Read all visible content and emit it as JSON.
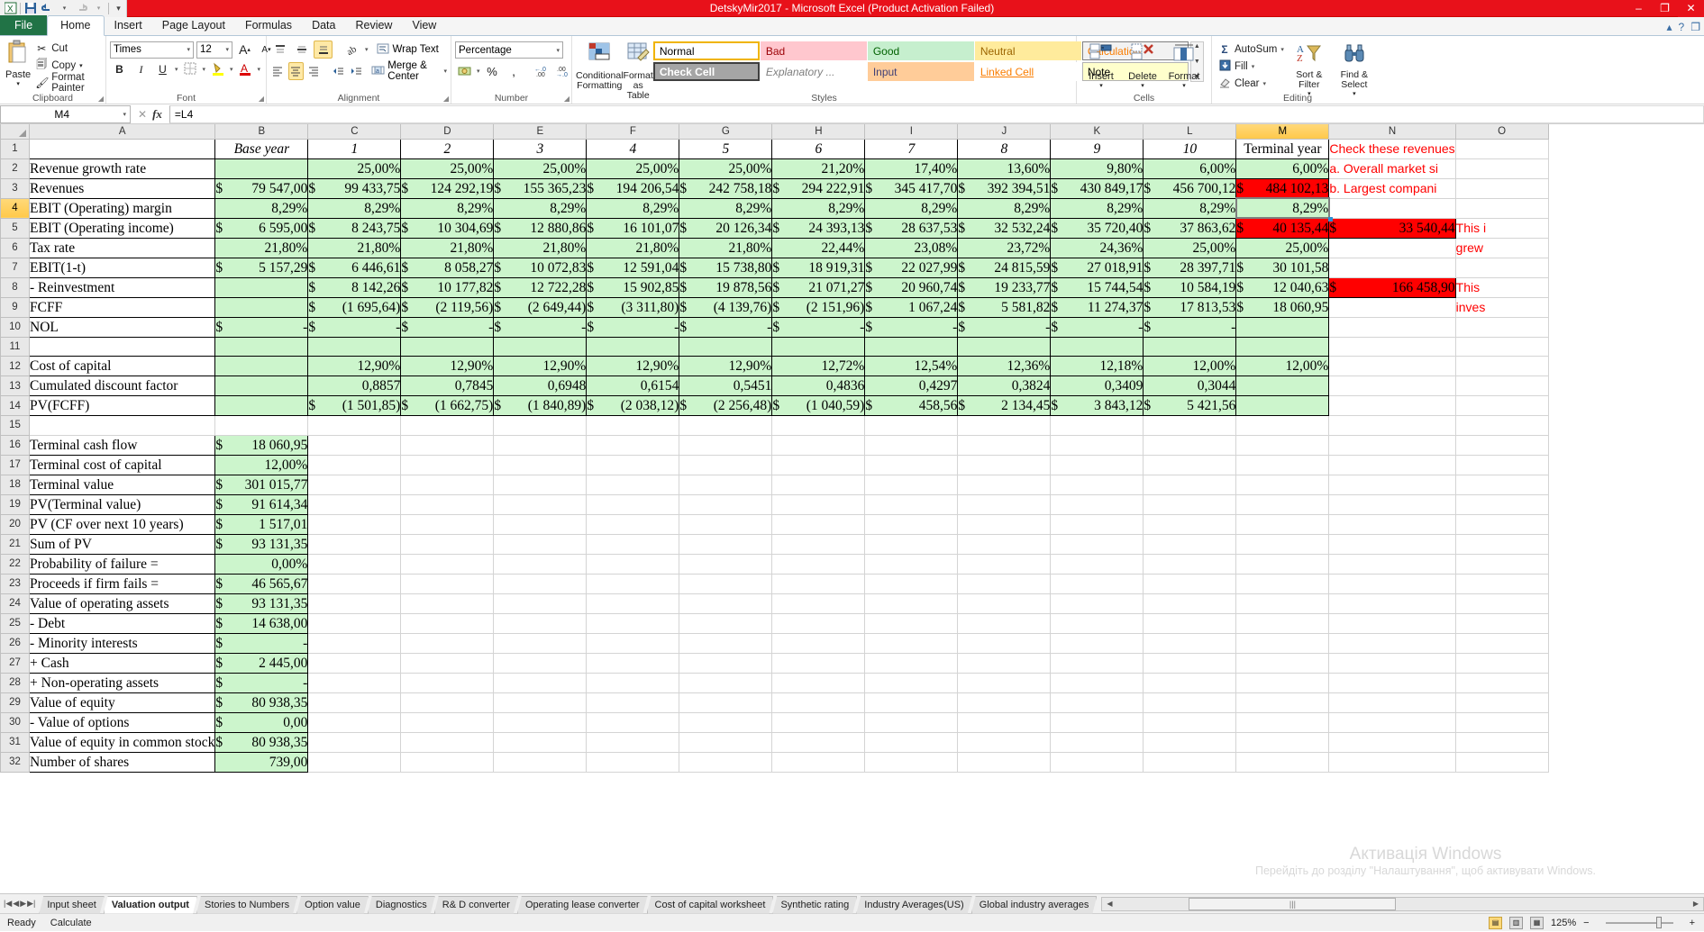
{
  "window": {
    "title": "DetskyMir2017  -  Microsoft Excel (Product Activation Failed)",
    "minimize": "–",
    "maximize": "❐",
    "close": "✕"
  },
  "quick_access": {
    "excel": "X",
    "save": "ὋE",
    "undo": "↶",
    "redo": "↷",
    "customize": "▾"
  },
  "ribbon_tabs": [
    {
      "label": "File",
      "active": false
    },
    {
      "label": "Home",
      "active": true
    },
    {
      "label": "Insert",
      "active": false
    },
    {
      "label": "Page Layout",
      "active": false
    },
    {
      "label": "Formulas",
      "active": false
    },
    {
      "label": "Data",
      "active": false
    },
    {
      "label": "Review",
      "active": false
    },
    {
      "label": "View",
      "active": false
    }
  ],
  "help_icons": {
    "minimize_ribbon": "▴",
    "help": "?",
    "restore": "❐"
  },
  "clipboard": {
    "group_label": "Clipboard",
    "paste": "Paste",
    "cut": "Cut",
    "copy": "Copy",
    "format_painter": "Format Painter"
  },
  "font_group": {
    "group_label": "Font",
    "font_name": "Times",
    "font_size": "12",
    "grow_font": "A",
    "shrink_font": "A",
    "bold": "B",
    "italic": "I",
    "underline": "U",
    "borders": "▦",
    "fill_color": "A",
    "font_color": "A"
  },
  "alignment_group": {
    "group_label": "Alignment",
    "wrap_text": "Wrap Text",
    "merge_center": "Merge & Center",
    "align_top": "≡",
    "align_middle": "≡",
    "align_bottom": "≡",
    "orientation": "↱",
    "align_left": "≡",
    "align_center": "≡",
    "align_right": "≡",
    "decrease_indent": "⇤",
    "increase_indent": "⇥"
  },
  "number_group": {
    "group_label": "Number",
    "format": "Percentage",
    "accounting": "$",
    "percent": "%",
    "comma": ",",
    "increase_decimal": ".00",
    "decrease_decimal": ".0"
  },
  "styles_group": {
    "group_label": "Styles",
    "conditional_formatting": "Conditional Formatting",
    "format_as_table": "Format as Table",
    "cells": [
      {
        "label": "Normal",
        "cls": "sc-normal"
      },
      {
        "label": "Bad",
        "cls": "sc-bad"
      },
      {
        "label": "Good",
        "cls": "sc-good"
      },
      {
        "label": "Neutral",
        "cls": "sc-neutral"
      },
      {
        "label": "Calculation",
        "cls": "sc-calc"
      },
      {
        "label": "Check Cell",
        "cls": "sc-check"
      },
      {
        "label": "Explanatory ...",
        "cls": "sc-expl"
      },
      {
        "label": "Input",
        "cls": "sc-input"
      },
      {
        "label": "Linked Cell",
        "cls": "sc-linked"
      },
      {
        "label": "Note",
        "cls": "sc-note"
      }
    ]
  },
  "cells_group": {
    "group_label": "Cells",
    "insert": "Insert",
    "delete": "Delete",
    "format": "Format"
  },
  "editing_group": {
    "group_label": "Editing",
    "autosum": "AutoSum",
    "fill": "Fill",
    "clear": "Clear",
    "sort_filter": "Sort & Filter",
    "find_select": "Find & Select"
  },
  "formula_bar": {
    "name_box": "M4",
    "formula": "=L4",
    "cancel": "✕",
    "enter": "✓",
    "fx": "fx"
  },
  "grid": {
    "columns": [
      "A",
      "B",
      "C",
      "D",
      "E",
      "F",
      "G",
      "H",
      "I",
      "J",
      "K",
      "L",
      "M",
      "N",
      "O"
    ],
    "selected_column": "M",
    "selected_row": 4,
    "headers_row": {
      "row": 1,
      "A": "",
      "B": "Base year",
      "years": [
        "1",
        "2",
        "3",
        "4",
        "5",
        "6",
        "7",
        "8",
        "9",
        "10"
      ],
      "M": "Terminal year"
    },
    "rows": [
      {
        "n": 2,
        "label": "Revenue growth rate",
        "cells": [
          "",
          "25,00%",
          "25,00%",
          "25,00%",
          "25,00%",
          "25,00%",
          "21,20%",
          "17,40%",
          "13,60%",
          "9,80%",
          "6,00%",
          "6,00%"
        ],
        "style": "pct"
      },
      {
        "n": 3,
        "label": "Revenues",
        "cells": [
          "$  79 547,00",
          "$  99 433,75",
          "$ 124 292,19",
          "$ 155 365,23",
          "$ 194 206,54",
          "$ 242 758,18",
          "$ 294 222,91",
          "$ 345 417,70",
          "$ 392 394,51",
          "$ 430 849,17",
          "$ 456 700,12",
          "$ 484 102,13"
        ],
        "style": "money",
        "red_last": true
      },
      {
        "n": 4,
        "label": "EBIT (Operating) margin",
        "cells": [
          "8,29%",
          "8,29%",
          "8,29%",
          "8,29%",
          "8,29%",
          "8,29%",
          "8,29%",
          "8,29%",
          "8,29%",
          "8,29%",
          "8,29%",
          "8,29%"
        ],
        "style": "pct"
      },
      {
        "n": 5,
        "label": "EBIT (Operating income)",
        "cells": [
          "$   6 595,00",
          "$   8 243,75",
          "$  10 304,69",
          "$  12 880,86",
          "$  16 101,07",
          "$  20 126,34",
          "$  24 393,13",
          "$  28 637,53",
          "$  32 532,24",
          "$  35 720,40",
          "$  37 863,62",
          "$  40 135,44"
        ],
        "style": "money",
        "red_last": true,
        "extra_n": "$       33 540,44",
        "extra_n_red": true
      },
      {
        "n": 6,
        "label": "Tax rate",
        "cells": [
          "21,80%",
          "21,80%",
          "21,80%",
          "21,80%",
          "21,80%",
          "21,80%",
          "22,44%",
          "23,08%",
          "23,72%",
          "24,36%",
          "25,00%",
          "25,00%"
        ],
        "style": "pct"
      },
      {
        "n": 7,
        "label": "EBIT(1-t)",
        "cells": [
          "$   5 157,29",
          "$   6 446,61",
          "$   8 058,27",
          "$  10 072,83",
          "$  12 591,04",
          "$  15 738,80",
          "$  18 919,31",
          "$  22 027,99",
          "$  24 815,59",
          "$  27 018,91",
          "$  28 397,71",
          "$  30 101,58"
        ],
        "style": "money"
      },
      {
        "n": 8,
        "label": " - Reinvestment",
        "cells": [
          "",
          "$   8 142,26",
          "$  10 177,82",
          "$  12 722,28",
          "$  15 902,85",
          "$  19 878,56",
          "$  21 071,27",
          "$  20 960,74",
          "$  19 233,77",
          "$  15 744,54",
          "$  10 584,19",
          "$  12 040,63"
        ],
        "style": "money",
        "extra_n": "$     166 458,90",
        "extra_n_red": true
      },
      {
        "n": 9,
        "label": "FCFF",
        "cells": [
          "",
          "$  (1 695,64)",
          "$  (2 119,56)",
          "$  (2 649,44)",
          "$  (3 311,80)",
          "$  (4 139,76)",
          "$  (2 151,96)",
          "$   1 067,24",
          "$   5 581,82",
          "$  11 274,37",
          "$  17 813,53",
          "$  18 060,95"
        ],
        "style": "money"
      },
      {
        "n": 10,
        "label": "NOL",
        "cells": [
          "$          -",
          "$          -",
          "$          -",
          "$          -",
          "$          -",
          "$          -",
          "$          -",
          "$          -",
          "$          -",
          "$          -",
          "$          -",
          ""
        ],
        "style": "money"
      },
      {
        "n": 11,
        "label": "",
        "cells": [
          "",
          "",
          "",
          "",
          "",
          "",
          "",
          "",
          "",
          "",
          "",
          ""
        ],
        "style": "blankrow"
      },
      {
        "n": 12,
        "label": "Cost of capital",
        "cells": [
          "",
          "12,90%",
          "12,90%",
          "12,90%",
          "12,90%",
          "12,90%",
          "12,72%",
          "12,54%",
          "12,36%",
          "12,18%",
          "12,00%",
          "12,00%"
        ],
        "style": "pct"
      },
      {
        "n": 13,
        "label": "Cumulated discount factor",
        "cells": [
          "",
          "0,8857",
          "0,7845",
          "0,6948",
          "0,6154",
          "0,5451",
          "0,4836",
          "0,4297",
          "0,3824",
          "0,3409",
          "0,3044",
          ""
        ],
        "style": "pct"
      },
      {
        "n": 14,
        "label": "PV(FCFF)",
        "cells": [
          "",
          "$  (1 501,85)",
          "$  (1 662,75)",
          "$  (1 840,89)",
          "$  (2 038,12)",
          "$  (2 256,48)",
          "$  (1 040,59)",
          "$     458,56",
          "$   2 134,45",
          "$   3 843,12",
          "$   5 421,56",
          ""
        ],
        "style": "money"
      },
      {
        "n": 15,
        "label": "",
        "cells": [],
        "style": "empty"
      },
      {
        "n": 16,
        "label": "Terminal cash flow",
        "single": "$  18 060,95",
        "style": "single"
      },
      {
        "n": 17,
        "label": "Terminal cost of capital",
        "single": "12,00%",
        "style": "single"
      },
      {
        "n": 18,
        "label": "Terminal value",
        "single": "$ 301 015,77",
        "style": "single"
      },
      {
        "n": 19,
        "label": "PV(Terminal value)",
        "single": "$  91 614,34",
        "style": "single"
      },
      {
        "n": 20,
        "label": "PV (CF over next 10 years)",
        "single": "$   1 517,01",
        "style": "single"
      },
      {
        "n": 21,
        "label": "Sum of PV",
        "single": "$  93 131,35",
        "style": "single"
      },
      {
        "n": 22,
        "label": "Probability of failure =",
        "single": "0,00%",
        "style": "single"
      },
      {
        "n": 23,
        "label": "Proceeds if firm fails =",
        "single": "$46 565,67",
        "style": "single"
      },
      {
        "n": 24,
        "label": "Value of operating assets",
        "single": "$  93 131,35",
        "style": "single"
      },
      {
        "n": 25,
        "label": " - Debt",
        "single": "$  14 638,00",
        "style": "single"
      },
      {
        "n": 26,
        "label": " - Minority interests",
        "single": "$          -",
        "style": "single"
      },
      {
        "n": 27,
        "label": " + Cash",
        "single": "$   2 445,00",
        "style": "single"
      },
      {
        "n": 28,
        "label": " + Non-operating assets",
        "single": "$          -",
        "style": "single"
      },
      {
        "n": 29,
        "label": "Value of equity",
        "single": "$  80 938,35",
        "style": "single"
      },
      {
        "n": 30,
        "label": " - Value of options",
        "single": "$0,00",
        "style": "single"
      },
      {
        "n": 31,
        "label": "Value of equity in common stock",
        "single": "$  80 938,35",
        "style": "single"
      },
      {
        "n": 32,
        "label": "Number of shares",
        "single": "739,00",
        "style": "single"
      }
    ],
    "notes": {
      "row1": "Check these revenues",
      "row1b": "a. Overall market si",
      "row1c": "b. Largest compani",
      "row5": "This i",
      "row6": "grew",
      "row8": "This"
    },
    "note_row8b": "inves"
  },
  "watermark": {
    "line1": "Активація Windows",
    "line2": "Перейдіть до розділу \"Налаштування\", щоб активувати Windows."
  },
  "sheet_tabs": [
    {
      "label": "Input sheet",
      "active": false
    },
    {
      "label": "Valuation output",
      "active": true
    },
    {
      "label": "Stories to Numbers",
      "active": false
    },
    {
      "label": "Option value",
      "active": false
    },
    {
      "label": "Diagnostics",
      "active": false
    },
    {
      "label": "R& D converter",
      "active": false
    },
    {
      "label": "Operating lease converter",
      "active": false
    },
    {
      "label": "Cost of capital worksheet",
      "active": false
    },
    {
      "label": "Synthetic rating",
      "active": false
    },
    {
      "label": "Industry Averages(US)",
      "active": false
    },
    {
      "label": "Global industry averages",
      "active": false
    }
  ],
  "status_bar": {
    "state": "Ready",
    "calc": "Calculate",
    "zoom": "125%",
    "zoom_out": "−",
    "zoom_in": "+"
  }
}
